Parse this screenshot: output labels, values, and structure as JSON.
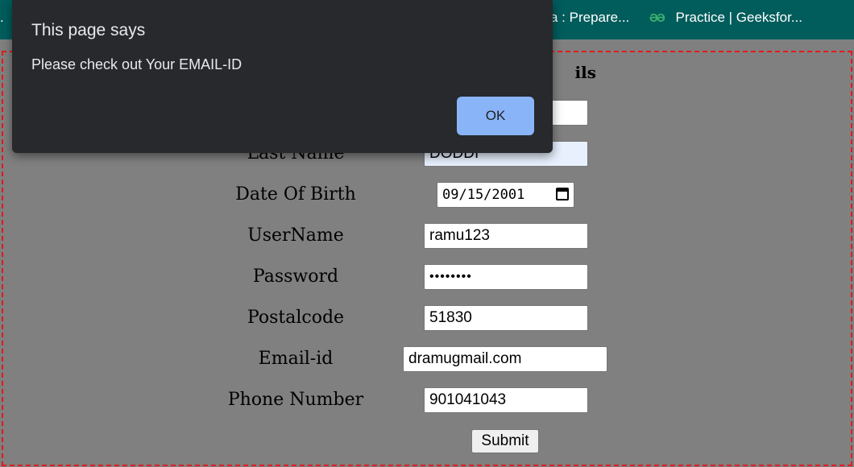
{
  "bookmarks_bar": {
    "items": [
      {
        "label": "a : Prepare..."
      },
      {
        "label": "Practice | Geeksfor...",
        "icon": "gfg-logo-icon",
        "icon_glyph": "ƏƏ",
        "icon_color": "#3ab06b"
      }
    ],
    "background": "#015c5c"
  },
  "alert_dialog": {
    "title": "This page says",
    "message": "Please check out Your EMAIL-ID",
    "ok_label": "OK",
    "ok_color": "#8ab4f8",
    "background": "#28292c"
  },
  "form": {
    "heading_visible_fragment": "ils",
    "fields": {
      "last_name": {
        "label": "Last Name",
        "value": "DODDI"
      },
      "date_of_birth": {
        "label": "Date Of Birth",
        "value": "09/15/2001"
      },
      "username": {
        "label": "UserName",
        "value": "ramu123"
      },
      "password": {
        "label": "Password",
        "value": "••••••••"
      },
      "postalcode": {
        "label": "Postalcode",
        "value": "51830"
      },
      "email": {
        "label": "Email-id",
        "value": "dramugmail.com"
      },
      "phone": {
        "label": "Phone Number",
        "value": "901041043"
      }
    },
    "submit_label": "Submit"
  },
  "colors": {
    "page_background": "#808080",
    "border_dashed": "#e11b1b",
    "autofill_field": "#e8f0fe"
  }
}
